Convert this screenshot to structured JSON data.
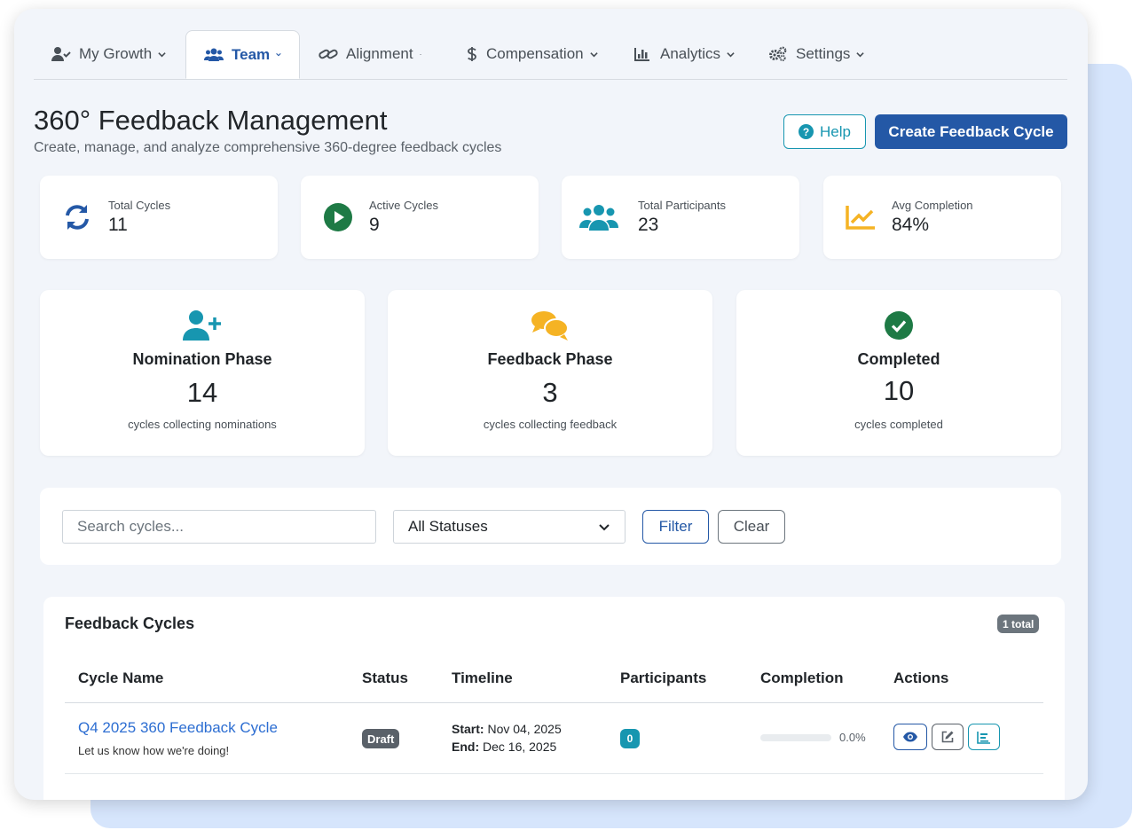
{
  "nav": {
    "tabs": [
      {
        "label": "My Growth",
        "icon": "user-check-icon"
      },
      {
        "label": "Team",
        "icon": "users-icon",
        "active": true
      },
      {
        "label": "Alignment",
        "icon": "link-icon"
      },
      {
        "label": "Compensation",
        "icon": "dollar-icon"
      },
      {
        "label": "Analytics",
        "icon": "chart-bar-icon"
      },
      {
        "label": "Settings",
        "icon": "cogs-icon"
      }
    ]
  },
  "header": {
    "title": "360° Feedback Management",
    "subtitle": "Create, manage, and analyze comprehensive 360-degree feedback cycles",
    "help_label": "Help",
    "create_label": "Create Feedback Cycle"
  },
  "stats": [
    {
      "label": "Total Cycles",
      "value": "11",
      "icon": "sync-icon",
      "color": "#2458a6"
    },
    {
      "label": "Active Cycles",
      "value": "9",
      "icon": "play-circle-icon",
      "color": "#1e7a45"
    },
    {
      "label": "Total Participants",
      "value": "23",
      "icon": "users-icon",
      "color": "#1796b0"
    },
    {
      "label": "Avg Completion",
      "value": "84%",
      "icon": "chart-line-icon",
      "color": "#f5b324"
    }
  ],
  "phases": [
    {
      "title": "Nomination Phase",
      "count": "14",
      "caption": "cycles collecting nominations",
      "icon": "user-plus-icon",
      "color": "#1796b0"
    },
    {
      "title": "Feedback Phase",
      "count": "3",
      "caption": "cycles collecting feedback",
      "icon": "comments-icon",
      "color": "#f5b324"
    },
    {
      "title": "Completed",
      "count": "10",
      "caption": "cycles completed",
      "icon": "check-circle-icon",
      "color": "#1e7a45"
    }
  ],
  "filters": {
    "search_placeholder": "Search cycles...",
    "status_selected": "All Statuses",
    "filter_label": "Filter",
    "clear_label": "Clear"
  },
  "table": {
    "title": "Feedback Cycles",
    "total_badge": "1 total",
    "columns": [
      "Cycle Name",
      "Status",
      "Timeline",
      "Participants",
      "Completion",
      "Actions"
    ],
    "rows": [
      {
        "name": "Q4 2025 360 Feedback Cycle",
        "description": "Let us know how we're doing!",
        "status": "Draft",
        "start_label": "Start:",
        "start": "Nov 04, 2025",
        "end_label": "End:",
        "end": "Dec 16, 2025",
        "participants": "0",
        "completion_text": "0.0%",
        "completion_fraction": 0.0
      }
    ]
  },
  "colors": {
    "primary": "#2458a6",
    "info": "#1796b0",
    "success": "#1e7a45",
    "warning": "#f5b324",
    "secondary": "#6c757d"
  }
}
